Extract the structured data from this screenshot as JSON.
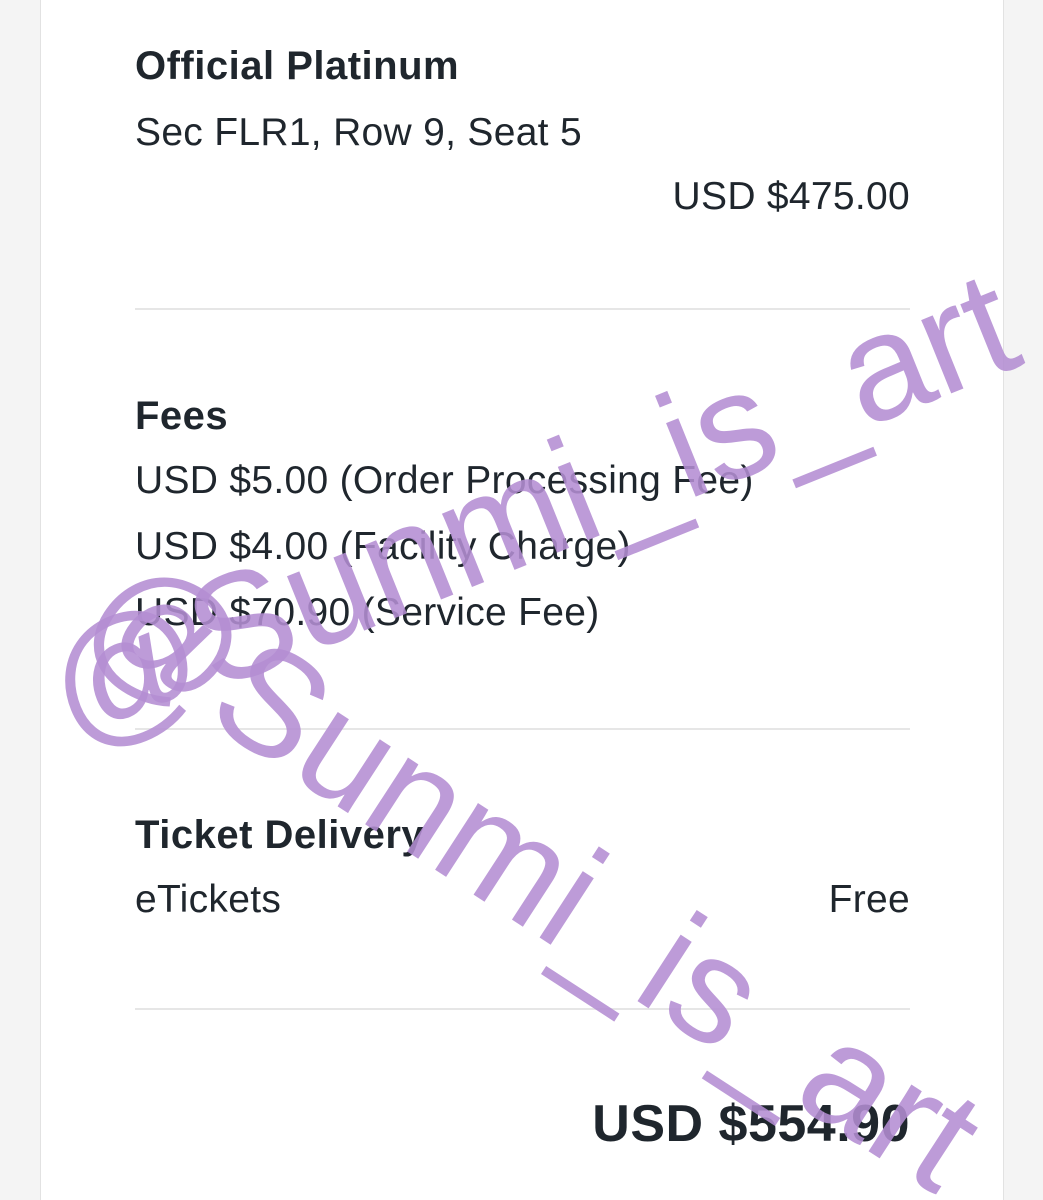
{
  "ticket": {
    "type": "Official Platinum",
    "seat": "Sec FLR1, Row 9, Seat 5",
    "price": "USD $475.00"
  },
  "fees": {
    "heading": "Fees",
    "items": [
      "USD $5.00 (Order Processing Fee)",
      "USD $4.00 (Facility Charge)",
      "USD $70.90 (Service Fee)"
    ]
  },
  "delivery": {
    "heading": "Ticket Delivery",
    "method": "eTickets",
    "cost": "Free"
  },
  "total": "USD $554.90",
  "watermark": {
    "text": "@Sunmi_is_art",
    "color": "#b48ed3"
  }
}
